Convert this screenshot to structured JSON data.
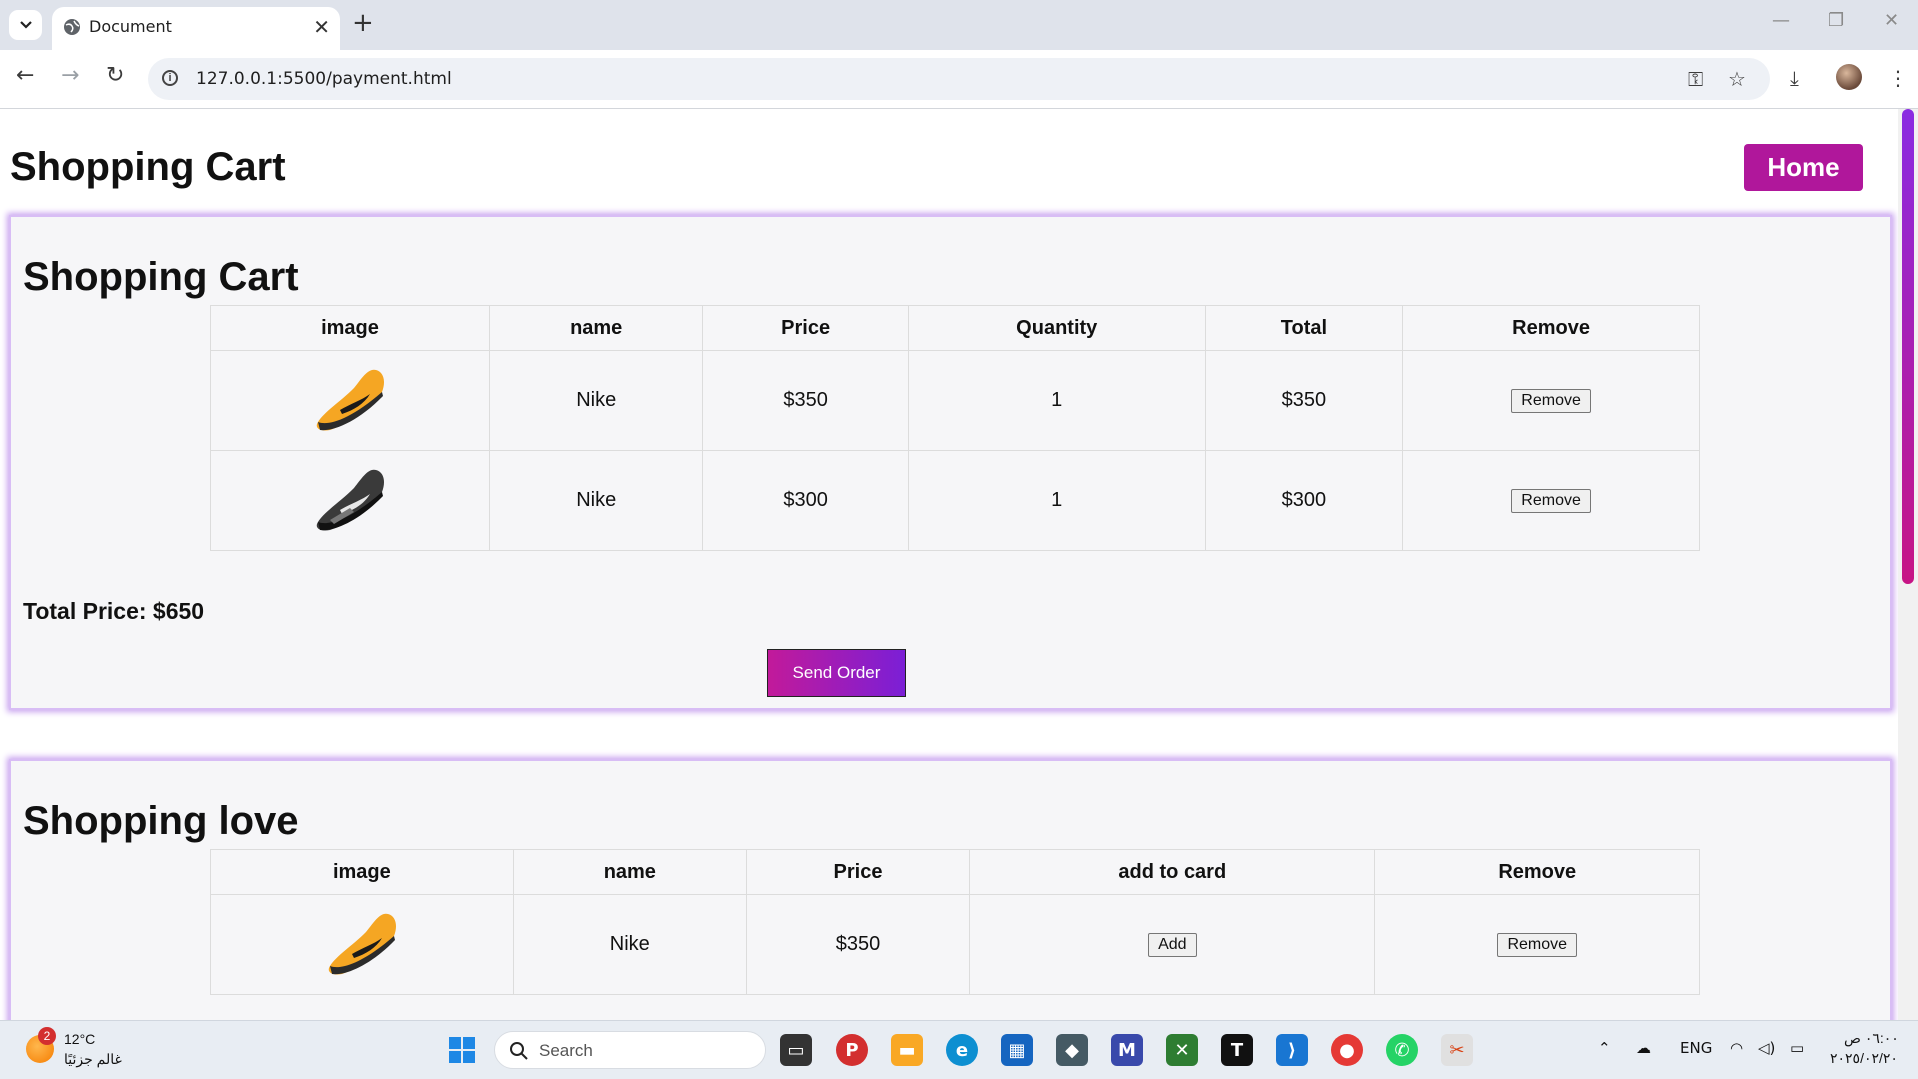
{
  "browser": {
    "tab_title": "Document",
    "tab_close": "✕",
    "new_tab": "+",
    "url": "127.0.0.1:5500/payment.html"
  },
  "page": {
    "title": "Shopping Cart",
    "home_label": "Home"
  },
  "cart": {
    "heading": "Shopping Cart",
    "columns": [
      "image",
      "name",
      "Price",
      "Quantity",
      "Total",
      "Remove"
    ],
    "rows": [
      {
        "shoe": "yellow-nike-shoe",
        "name": "Nike",
        "price": "$350",
        "quantity": "1",
        "total": "$350",
        "remove_label": "Remove"
      },
      {
        "shoe": "black-nike-shoe",
        "name": "Nike",
        "price": "$300",
        "quantity": "1",
        "total": "$300",
        "remove_label": "Remove"
      }
    ],
    "total_price": "Total Price: $650",
    "send_label": "Send Order"
  },
  "love": {
    "heading": "Shopping love",
    "columns": [
      "image",
      "name",
      "Price",
      "add to card",
      "Remove"
    ],
    "rows": [
      {
        "shoe": "yellow-nike-shoe",
        "name": "Nike",
        "price": "$350",
        "add_label": "Add",
        "remove_label": "Remove"
      }
    ]
  },
  "taskbar": {
    "weather_badge": "2",
    "weather_temp": "12°C",
    "weather_desc": "غالم جزئيًا",
    "search_placeholder": "Search",
    "language": "ENG",
    "time": "٠٦:٠٠ ص",
    "date": "٢٠٢٥/٠٢/٢٠"
  },
  "colors": {
    "accent": "#b0179b",
    "gradient_start": "#c21a9a",
    "gradient_end": "#7b1fd6",
    "panel_glow": "#c9a3f0"
  }
}
